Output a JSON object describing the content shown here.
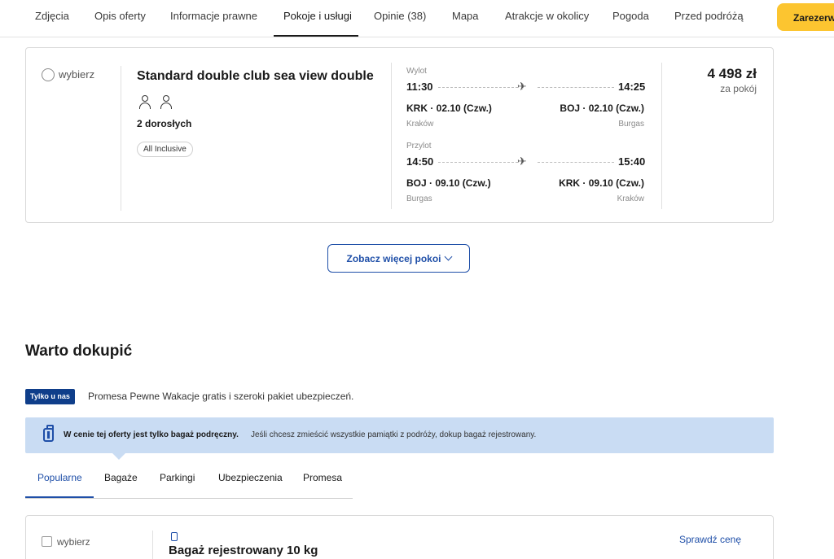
{
  "nav": {
    "items": [
      "Zdjęcia",
      "Opis oferty",
      "Informacje prawne",
      "Pokoje i usługi",
      "Opinie (38)",
      "Mapa",
      "Atrakcje w okolicy",
      "Pogoda",
      "Przed podróżą"
    ],
    "active": "Pokoje i usługi",
    "book_label": "Zarezerwuj"
  },
  "room": {
    "select_label": "wybierz",
    "title": "Standard double club sea view double",
    "occupancy": "2 dorosłych",
    "board": "All Inclusive",
    "price": "4 498 zł",
    "price_unit": "za pokój",
    "outbound": {
      "label": "Wylot",
      "dep_time": "11:30",
      "arr_time": "14:25",
      "dep_airport": "KRK · 02.10 (Czw.)",
      "arr_airport": "BOJ · 02.10 (Czw.)",
      "dep_city": "Kraków",
      "arr_city": "Burgas"
    },
    "return": {
      "label": "Przylot",
      "dep_time": "14:50",
      "arr_time": "15:40",
      "dep_airport": "BOJ · 09.10 (Czw.)",
      "arr_airport": "KRK · 09.10 (Czw.)",
      "dep_city": "Burgas",
      "arr_city": "Kraków"
    }
  },
  "more_rooms_label": "Zobacz więcej pokoi",
  "extras": {
    "title": "Warto dokupić",
    "only_badge": "Tylko u nas",
    "promo_text": "Promesa Pewne Wakacje gratis i szeroki pakiet ubezpieczeń.",
    "banner_bold": "W cenie tej oferty jest tylko bagaż podręczny.",
    "banner_text": "Jeśli chcesz zmieścić wszystkie pamiątki z podróży, dokup bagaż rejestrowany.",
    "tabs": [
      "Popularne",
      "Bagaże",
      "Parkingi",
      "Ubezpieczenia",
      "Promesa"
    ],
    "active_tab": "Popularne",
    "addon": {
      "select_label": "wybierz",
      "title": "Bagaż rejestrowany 10 kg",
      "action": "Sprawdź cenę"
    }
  },
  "colors": {
    "accent_blue": "#1f4fa8",
    "book_yellow": "#fcc530",
    "banner_bg": "#c9dcf3",
    "badge_navy": "#0f3e8a"
  }
}
